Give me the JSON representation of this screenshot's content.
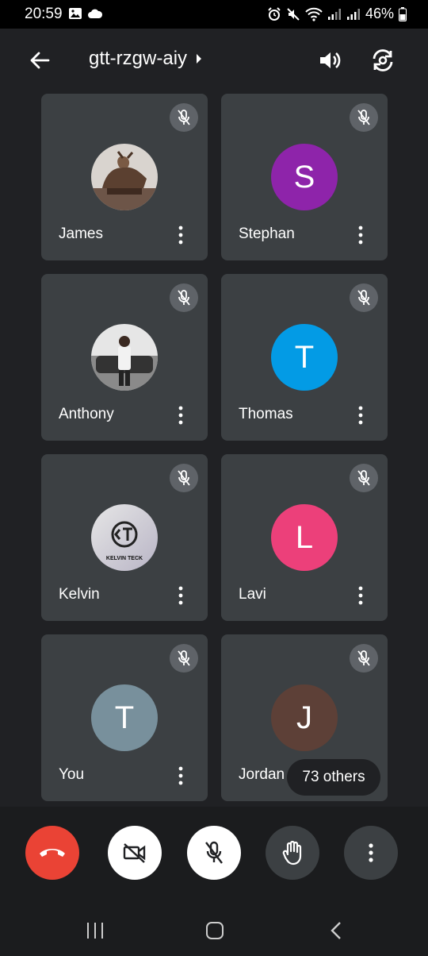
{
  "status_bar": {
    "time": "20:59",
    "battery": "46%"
  },
  "app_bar": {
    "meeting_code": "gtt-rzgw-aiy"
  },
  "participants": [
    {
      "name": "James",
      "avatar_type": "photo",
      "avatar_desc": "bull-statue-photo"
    },
    {
      "name": "Stephan",
      "avatar_type": "initial",
      "initial": "S",
      "color": "#8e24aa"
    },
    {
      "name": "Anthony",
      "avatar_type": "photo",
      "avatar_desc": "person-by-car-photo"
    },
    {
      "name": "Thomas",
      "avatar_type": "initial",
      "initial": "T",
      "color": "#039be5"
    },
    {
      "name": "Kelvin",
      "avatar_type": "photo",
      "avatar_desc": "kelvin-teck-logo",
      "logo_text": "KELVIN TECK"
    },
    {
      "name": "Lavi",
      "avatar_type": "initial",
      "initial": "L",
      "color": "#ec407a"
    },
    {
      "name": "You",
      "avatar_type": "initial",
      "initial": "T",
      "color": "#78909c"
    },
    {
      "name": "Jordan",
      "avatar_type": "initial",
      "initial": "J",
      "color": "#5d4037"
    }
  ],
  "others_chip": "73 others",
  "colors": {
    "end_call": "#ea4335",
    "tile_bg": "#3c4043",
    "background": "#202124"
  }
}
